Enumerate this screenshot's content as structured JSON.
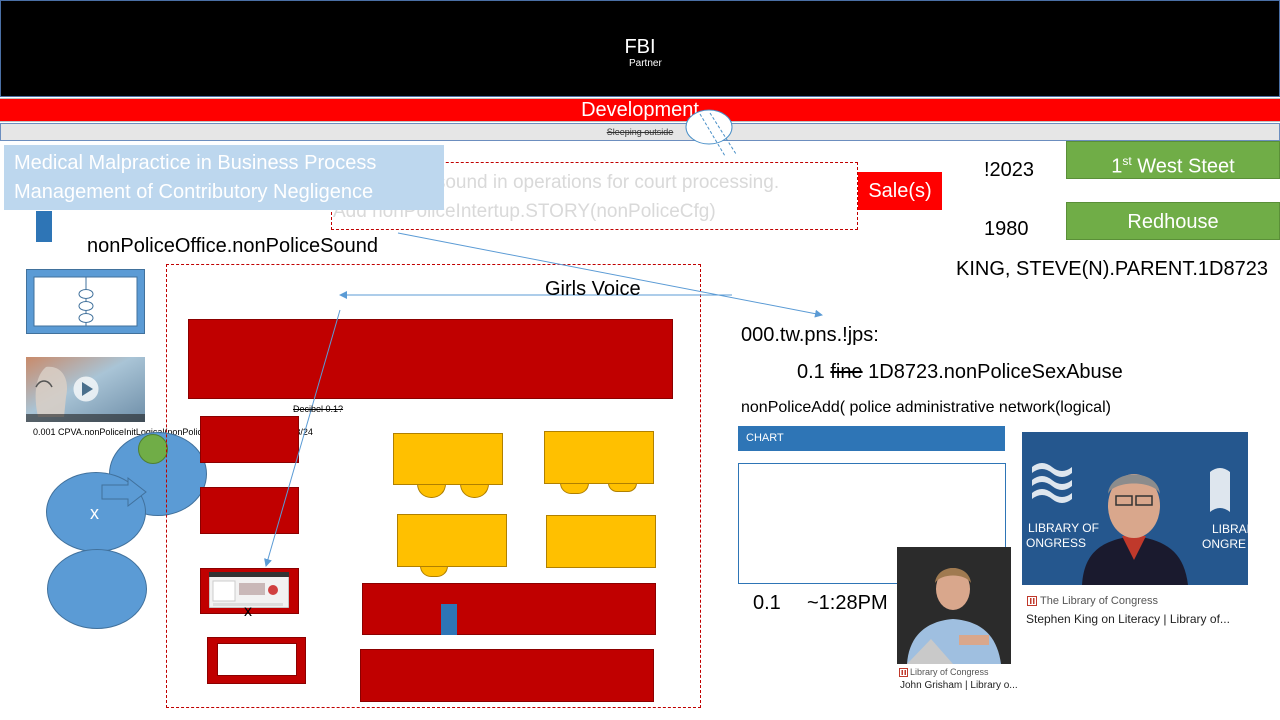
{
  "header": {
    "title": "FBI",
    "subtitle": "Partner"
  },
  "dev_bar": {
    "label": "Development"
  },
  "sleep_bar": {
    "label": "Sleeping outside"
  },
  "medical_box": {
    "line1": "Medical Malpractice in Business Process",
    "line2": "Management of Contributory Negligence"
  },
  "sound_box": {
    "line1": "e sound in operations for court processing.",
    "line2": "Add nonPoliceIntertup.STORY(nonPoliceCfg)"
  },
  "sales_button": {
    "label": "Sale(s)"
  },
  "year1": "!2023",
  "year2": "1980",
  "street_button": {
    "prefix": "1",
    "sup": "st",
    "rest": " West Steet"
  },
  "redhouse_button": {
    "label": "Redhouse"
  },
  "king_text": "KING, STEVE(N).PARENT.1D8723",
  "office_label": "nonPoliceOffice.nonPoliceSound",
  "girls_voice": "Girls Voice",
  "decibel_label": "Decibel 0.1?",
  "cpva_label": "0.001 CPVA.nonPoliceInitLogical(nonPoliceStory.&.ext 1D-24-2023/24",
  "x_marks": [
    "x",
    "x"
  ],
  "tw_text": "000.tw.pns.!jps:",
  "fine_line": {
    "prefix": "0.1 ",
    "struck": "fine",
    "rest": " 1D8723.nonPoliceSexAbuse"
  },
  "add_line": "nonPoliceAdd( police administrative network(logical)",
  "chart_panel": {
    "header": "CHART"
  },
  "bottom_value": "0.1",
  "bottom_time": "~1:28PM",
  "king_card": {
    "source": "The Library of Congress",
    "title": "Stephen King on Literacy | Library of..."
  },
  "grisham_card": {
    "source": "Library of Congress",
    "title": "John Grisham | Library o..."
  },
  "icons": {
    "video_thumbnail": "video-thumbnail-icon",
    "play": "play-icon",
    "arrow": "arrow-right-icon"
  },
  "colors": {
    "red": "#ff0000",
    "dark_red": "#c00000",
    "green": "#70ad47",
    "blue": "#2e75b6",
    "yellow": "#ffc000",
    "light_blue": "#bdd7ee"
  }
}
